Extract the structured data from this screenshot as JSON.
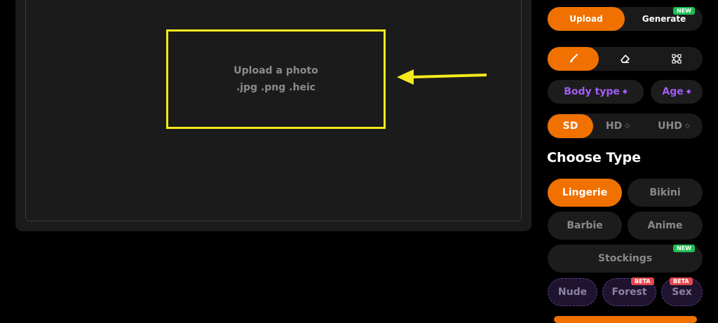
{
  "upload": {
    "line1": "Upload a photo",
    "line2": ".jpg .png .heic"
  },
  "mode_tabs": {
    "upload": "Upload",
    "generate": "Generate",
    "generate_badge": "NEW"
  },
  "tools": [
    "brush-icon",
    "eraser-icon",
    "select-icon"
  ],
  "options": {
    "body_type": "Body type",
    "age": "Age"
  },
  "quality": {
    "sd": "SD",
    "hd": "HD",
    "uhd": "UHD"
  },
  "section_title": "Choose Type",
  "types": {
    "lingerie": "Lingerie",
    "bikini": "Bikini",
    "barbie": "Barbie",
    "anime": "Anime",
    "stockings": "Stockings",
    "stockings_badge": "NEW",
    "nude": "Nude",
    "forest": "Forest",
    "forest_badge": "BETA",
    "sex": "Sex",
    "sex_badge": "BETA"
  },
  "colors": {
    "accent": "#f07100",
    "highlight": "#f6ea1c",
    "premium": "#a25cf5"
  }
}
